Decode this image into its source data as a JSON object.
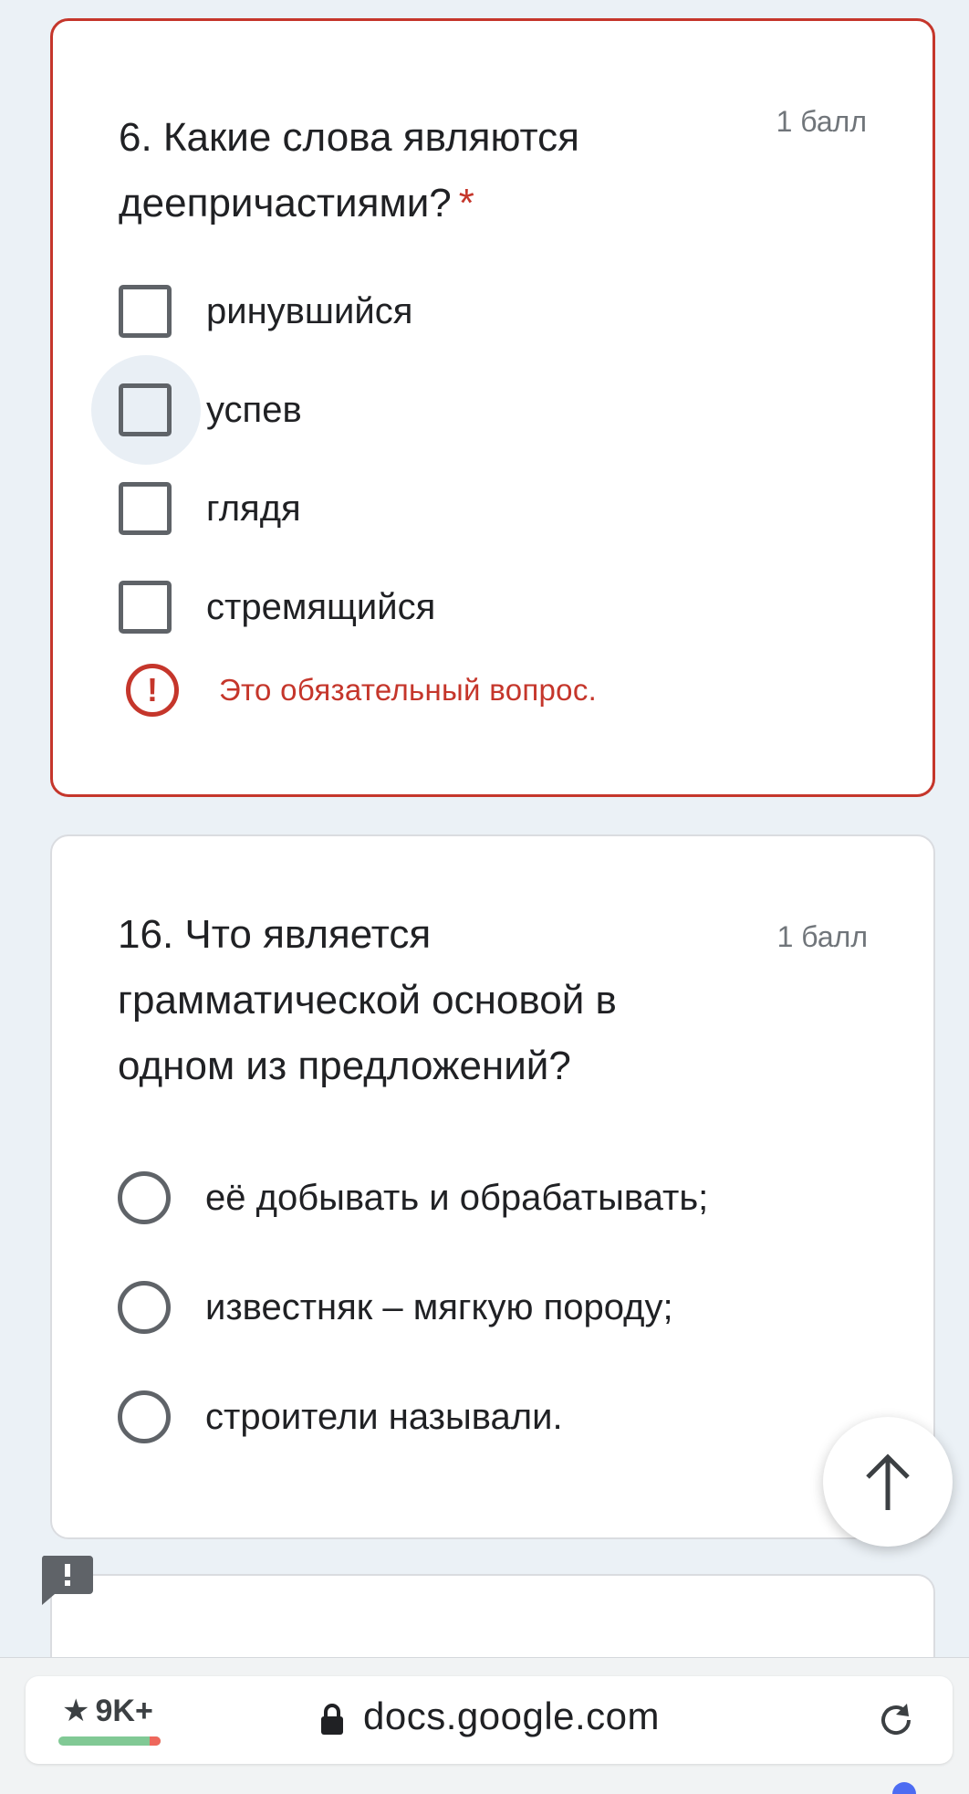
{
  "question6": {
    "title": "6. Какие слова являются деепричастиями?",
    "required_mark": "*",
    "points": "1 балл",
    "options": [
      "ринувшийся",
      "успев",
      "глядя",
      "стремящийся"
    ],
    "error": "Это обязательный вопрос."
  },
  "question16": {
    "title": "16. Что является грамматической основой в одном из предложений?",
    "points": "1 балл",
    "options": [
      "её добывать и обрабатывать;",
      "известняк – мягкую породу;",
      "строители называли."
    ]
  },
  "browser": {
    "tabs_count": "9K+",
    "url": "docs.google.com"
  },
  "icons": {
    "error": "error-circle-icon",
    "scroll_top": "arrow-up-icon",
    "report": "report-icon",
    "lock": "lock-icon",
    "reload": "reload-icon",
    "star": "star-icon"
  },
  "colors": {
    "error": "#c5362b",
    "background": "#ebf1f6"
  }
}
